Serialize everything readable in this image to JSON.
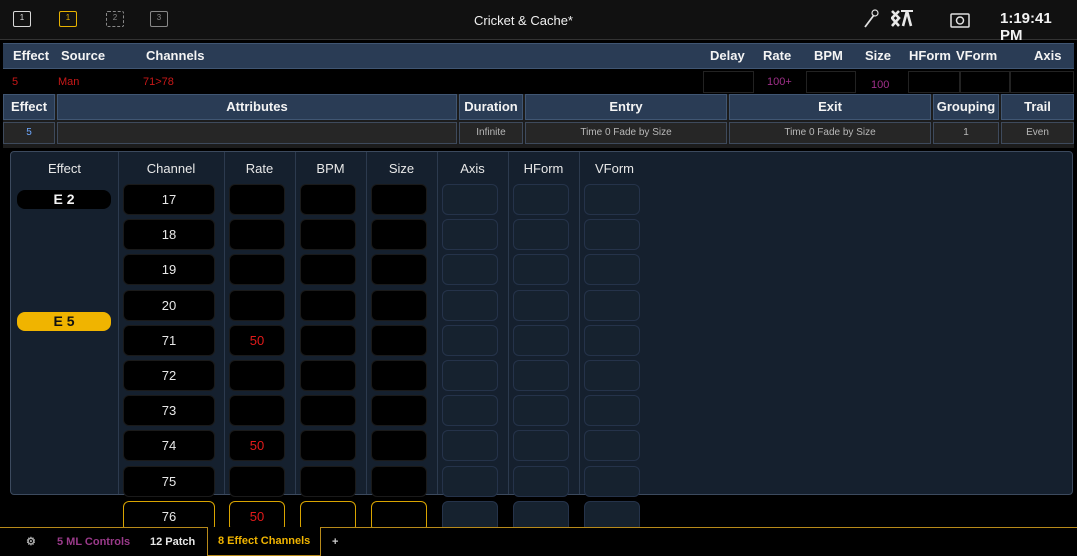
{
  "app": {
    "title": "Cricket & Cache*",
    "clock": "1:19:41 PM"
  },
  "topbar": {
    "icons": [
      "monitor-icon",
      "tab-1-icon",
      "tab-2-icon",
      "tab-3-icon",
      "magic-wand-icon",
      "xa-logo-icon",
      "camera-icon"
    ],
    "tab_icons": [
      "1",
      "1",
      "2",
      "3"
    ]
  },
  "header": {
    "cols": [
      "Effect",
      "Source",
      "Channels",
      "Delay",
      "Rate",
      "BPM",
      "Size",
      "HForm",
      "VForm",
      "Axis"
    ]
  },
  "datarow": {
    "effect": "5",
    "source": "Man",
    "channels": "71>78",
    "rate": "100+",
    "size": "100"
  },
  "band2": {
    "heads": [
      "Effect",
      "Attributes",
      "Duration",
      "Entry",
      "Exit",
      "Grouping",
      "Trail"
    ],
    "values": [
      "5",
      "",
      "Infinite",
      "Time 0 Fade by Size",
      "Time 0 Fade by Size",
      "1",
      "Even"
    ]
  },
  "table": {
    "heads": [
      "Effect",
      "Channel",
      "Rate",
      "BPM",
      "Size",
      "Axis",
      "HForm",
      "VForm"
    ],
    "effects": [
      "E 2",
      "E 5"
    ],
    "rows": [
      {
        "channel": "17",
        "rate": ""
      },
      {
        "channel": "18",
        "rate": ""
      },
      {
        "channel": "19",
        "rate": ""
      },
      {
        "channel": "20",
        "rate": ""
      },
      {
        "channel": "71",
        "rate": "50"
      },
      {
        "channel": "72",
        "rate": ""
      },
      {
        "channel": "73",
        "rate": ""
      },
      {
        "channel": "74",
        "rate": "50"
      },
      {
        "channel": "75",
        "rate": ""
      },
      {
        "channel": "76",
        "rate": "50"
      }
    ]
  },
  "tabs": {
    "gear": "⚙",
    "items": [
      "5 ML Controls",
      "12 Patch",
      "8 Effect Channels",
      "+"
    ],
    "active": "8 Effect Channels"
  },
  "colors": {
    "accent": "#f0b400",
    "header_bg": "#2a3c55",
    "red_value": "#e21a1a",
    "tab_faded": "#9a3a8a"
  }
}
